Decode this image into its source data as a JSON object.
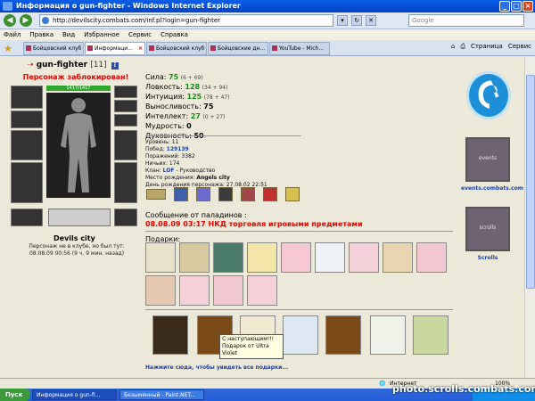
{
  "window": {
    "title": "Информация о gun-fighter - Windows Internet Explorer"
  },
  "address": {
    "url": "http://devilscity.combats.com/inf.pl?login=gun-fighter",
    "search_placeholder": "Google"
  },
  "menu": [
    "Файл",
    "Правка",
    "Вид",
    "Избранное",
    "Сервис",
    "Справка"
  ],
  "tabs": [
    {
      "label": "Бойцовский клуб",
      "active": false
    },
    {
      "label": "Информаци...",
      "active": true
    },
    {
      "label": "Бойцовский клуб",
      "active": false
    },
    {
      "label": "Бойцовские дн...",
      "active": false
    },
    {
      "label": "YouTube - Mich...",
      "active": false
    }
  ],
  "toolbar_right": {
    "page": "Страница",
    "service": "Сервис"
  },
  "character": {
    "name": "gun-fighter",
    "level": "[11]",
    "blocked": "Персонаж заблокирован!",
    "hp": "1417/1417",
    "city": "Devils city",
    "not_in_club_1": "Персонаж не в клубе, но был тут:",
    "not_in_club_2": "08.08.09 00:56 (9 ч. 9 мин. назад)"
  },
  "stats": [
    {
      "label": "Сила:",
      "value": "75",
      "extra": "(6 + 69)",
      "green": true
    },
    {
      "label": "Ловкость:",
      "value": "128",
      "extra": "(34 + 94)",
      "green": true
    },
    {
      "label": "Интуиция:",
      "value": "125",
      "extra": "(78 + 47)",
      "green": true
    },
    {
      "label": "Выносливость:",
      "value": "75",
      "extra": "",
      "green": false
    },
    {
      "label": "Интеллект:",
      "value": "27",
      "extra": "(0 + 27)",
      "green": true
    },
    {
      "label": "Мудрость:",
      "value": "0",
      "extra": "",
      "green": false
    },
    {
      "label": "Духовность:",
      "value": "50",
      "extra": "",
      "green": false
    }
  ],
  "details": {
    "level": "Уровень: 11",
    "wins_label": "Побед:",
    "wins": "129139",
    "losses": "Поражений: 3382",
    "draws": "Ничьих: 174",
    "clan_label": "Клан:",
    "clan": "LOF",
    "clan_role": " - Руководство",
    "birthplace_label": "Место рождения:",
    "birthplace": "Angels city",
    "birthday": "День рождения персонажа: 27.08.02 22:51"
  },
  "paladin": {
    "heading": "Сообщение от паладинов :",
    "message": "08.08.09 03:17 НКД торговля игровыми предметами"
  },
  "gifts": {
    "heading": "Подарки:",
    "tooltip_1": "С наступающим!!!",
    "tooltip_2": "Подарок от Ultra Violet",
    "more": "Нажмите сюда, чтобы увидеть все подарки..."
  },
  "right": {
    "events": "events.combats.com",
    "scrolls": "Scrolls",
    "banner1_text": "events",
    "banner2_text": "scrolls"
  },
  "status": {
    "zone": "Интернет",
    "zoom": "100%"
  },
  "taskbar": {
    "start": "Пуск",
    "tasks": [
      "Информация о gun-fi...",
      "Безымянный - Paint.NET..."
    ]
  },
  "watermark": "photo.scrolls.combats.com",
  "colors": {
    "accent_green": "#1a8c1a",
    "alert_red": "#e00000",
    "link_blue": "#1d3fa8"
  }
}
